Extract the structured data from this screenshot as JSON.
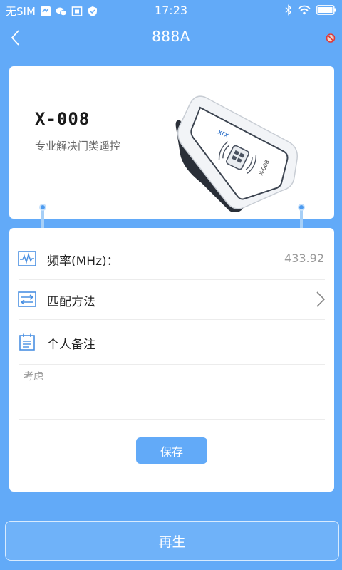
{
  "status_bar": {
    "carrier": "无SIM",
    "time": "17:23",
    "icons_left": [
      "notification-icon",
      "wechat-icon",
      "screenshot-icon",
      "shield-icon"
    ],
    "icons_right": [
      "bluetooth-icon",
      "wifi-icon",
      "battery-icon"
    ]
  },
  "nav": {
    "title": "888A",
    "back_icon": "chevron-left-icon",
    "extra_icon": "no-fire-icon"
  },
  "product": {
    "model": "X-008",
    "description": "专业解决门类遥控",
    "device_label": "X-008",
    "device_brand": "xrx"
  },
  "settings": {
    "frequency_label": "频率(MHz)：",
    "frequency_value": "433.92",
    "match_method_label": "匹配方法",
    "note_label": "个人备注",
    "note_placeholder": "考虑",
    "save_label": "保存"
  },
  "footer": {
    "regen_label": "再生"
  },
  "colors": {
    "background": "#62aaf8",
    "accent": "#4d9bf0",
    "card": "#ffffff",
    "icon_blue": "#4a90e2"
  }
}
